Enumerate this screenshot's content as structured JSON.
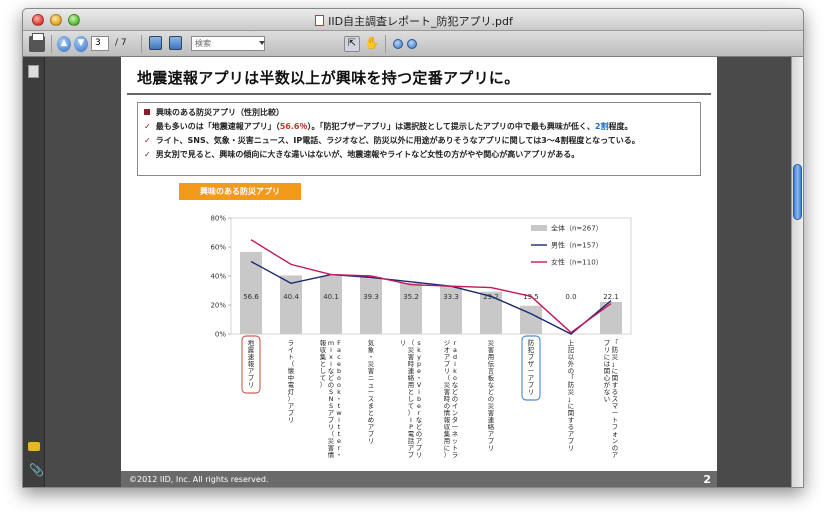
{
  "window": {
    "title": "IID自主調査レポート_防犯アプリ.pdf"
  },
  "toolbar": {
    "page_current": "3",
    "page_total": "/ 7",
    "search_placeholder": "検索"
  },
  "page": {
    "title": "地震速報アプリは半数以上が興味を持つ定番アプリに。",
    "bullets_heading": "興味のある防災アプリ（性別比較）",
    "bullets": [
      [
        "最も多いのは「地震速報アプリ」（",
        "56.6％",
        "）。「防犯ブザーアプリ」は選択肢として提示したアプリの中で最も興味が低く、",
        "2割",
        "程度。"
      ],
      [
        "ライト、SNS、気象・災害ニュース、IP電話、ラジオなど、防災以外に用途がありそうなアプリに関しては3～4割程度となっている。"
      ],
      [
        "男女別で見ると、興味の傾向に大きな違いはないが、地震速報やライトなど女性の方がやや関心が高いアプリがある。"
      ]
    ],
    "section_label": "興味のある防災アプリ",
    "footer_copyright": "©2012  IID, Inc.  All rights reserved.",
    "page_number": "2"
  },
  "colors": {
    "bar": "#c8c8c8",
    "male": "#1a2a6c",
    "female": "#c2185b",
    "accent_orange": "#f39a1b",
    "accent_dark_red": "#8b1c2b"
  },
  "chart_data": {
    "type": "bar",
    "title": "",
    "xlabel": "",
    "ylabel": "",
    "ylim": [
      0,
      80
    ],
    "y_ticks": [
      "0%",
      "20%",
      "40%",
      "60%",
      "80%"
    ],
    "categories": [
      "地震速報アプリ",
      "ライト（懐中電灯）アプリ",
      "Facebook・twitter・mixiなどのSNSアプリ（災害情報収集として）",
      "気象・災害ニュースまとめアプリ",
      "skype・Viberなどのアプリ（災害時連絡用として）IP電話アプリ",
      "radikoなどのインターネットラジオアプリ（災害時の情報収集用に）",
      "災害用伝言板などの災害連絡アプリ",
      "防犯ブザーアプリ",
      "上記以外の「防災」に関するアプリ",
      "「防災」に関するスマートフォンのアプリには関心がない"
    ],
    "highlighted_categories": [
      0,
      7
    ],
    "series": [
      {
        "name": "全体（n=267）",
        "kind": "bar",
        "values": [
          56.6,
          40.4,
          40.1,
          39.3,
          35.2,
          33.3,
          29.2,
          19.5,
          0.0,
          22.1
        ]
      },
      {
        "name": "男性（n=157）",
        "kind": "line",
        "values": [
          50,
          35,
          41,
          39,
          36,
          33,
          26,
          14,
          0,
          23
        ]
      },
      {
        "name": "女性（n=110）",
        "kind": "line",
        "values": [
          65,
          48,
          41,
          40,
          34,
          33,
          32,
          26,
          1,
          21
        ]
      }
    ],
    "data_labels": [
      "56.6",
      "40.4",
      "40.1",
      "39.3",
      "35.2",
      "33.3",
      "29.2",
      "19.5",
      "0.0",
      "22.1"
    ],
    "legend_position": "top-right",
    "grid": false
  }
}
